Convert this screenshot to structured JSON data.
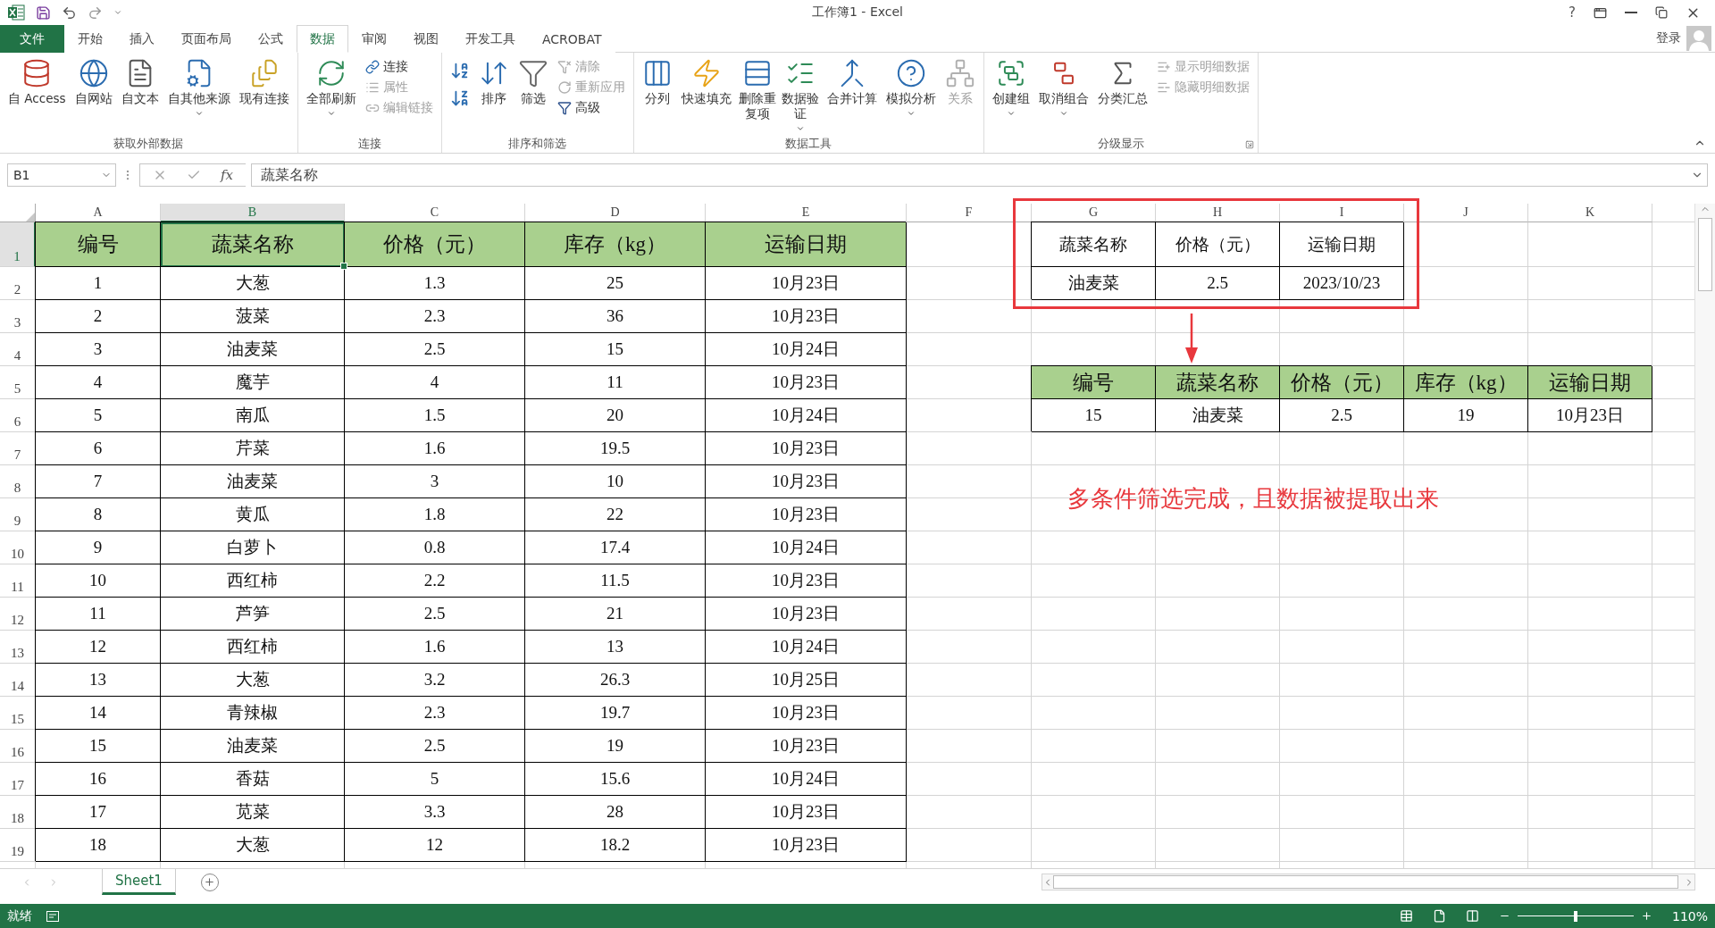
{
  "window": {
    "title": "工作簿1 - Excel",
    "help": "?"
  },
  "ribbon_tabs": [
    {
      "label": "文件",
      "kind": "file",
      "selected": false
    },
    {
      "label": "开始",
      "kind": "tab",
      "selected": false
    },
    {
      "label": "插入",
      "kind": "tab",
      "selected": false
    },
    {
      "label": "页面布局",
      "kind": "tab",
      "selected": false
    },
    {
      "label": "公式",
      "kind": "tab",
      "selected": false
    },
    {
      "label": "数据",
      "kind": "tab",
      "selected": true
    },
    {
      "label": "审阅",
      "kind": "tab",
      "selected": false
    },
    {
      "label": "视图",
      "kind": "tab",
      "selected": false
    },
    {
      "label": "开发工具",
      "kind": "tab",
      "selected": false
    },
    {
      "label": "ACROBAT",
      "kind": "tab",
      "selected": false
    }
  ],
  "account": {
    "label": "登录"
  },
  "ribbon_groups": [
    {
      "title": "获取外部数据",
      "dialog_launcher": false,
      "buttons": [
        {
          "label": "自 Access",
          "kind": "large",
          "disabled": false,
          "dropdown": false
        },
        {
          "label": "自网站",
          "kind": "large",
          "disabled": false,
          "dropdown": false
        },
        {
          "label": "自文本",
          "kind": "large",
          "disabled": false,
          "dropdown": false
        },
        {
          "label": "自其他来源",
          "kind": "large",
          "disabled": false,
          "dropdown": true
        },
        {
          "label": "现有连接",
          "kind": "large",
          "disabled": false,
          "dropdown": false
        }
      ]
    },
    {
      "title": "连接",
      "dialog_launcher": false,
      "buttons": [
        {
          "label": "全部刷新",
          "kind": "large",
          "disabled": false,
          "dropdown": true
        },
        {
          "label": "连接",
          "kind": "small",
          "disabled": false,
          "dropdown": false
        },
        {
          "label": "属性",
          "kind": "small",
          "disabled": true,
          "dropdown": false
        },
        {
          "label": "编辑链接",
          "kind": "small",
          "disabled": true,
          "dropdown": false
        }
      ]
    },
    {
      "title": "排序和筛选",
      "dialog_launcher": false,
      "buttons": [
        {
          "kind": "icon",
          "disabled": false
        },
        {
          "kind": "icon",
          "disabled": false
        },
        {
          "label": "排序",
          "kind": "large",
          "disabled": false,
          "dropdown": false
        },
        {
          "label": "筛选",
          "kind": "large",
          "disabled": false,
          "dropdown": false
        },
        {
          "label": "清除",
          "kind": "small",
          "disabled": true,
          "dropdown": false
        },
        {
          "label": "重新应用",
          "kind": "small",
          "disabled": true,
          "dropdown": false
        },
        {
          "label": "高级",
          "kind": "small",
          "disabled": false,
          "dropdown": false
        }
      ]
    },
    {
      "title": "数据工具",
      "dialog_launcher": false,
      "buttons": [
        {
          "label": "分列",
          "kind": "large",
          "disabled": false,
          "dropdown": false
        },
        {
          "label": "快速填充",
          "kind": "large",
          "disabled": false,
          "dropdown": false
        },
        {
          "label": "删除重复项",
          "kind": "wrapped",
          "disabled": false,
          "dropdown": false
        },
        {
          "label": "数据验证",
          "kind": "wrapped",
          "disabled": false,
          "dropdown": true
        },
        {
          "label": "合并计算",
          "kind": "large",
          "disabled": false,
          "dropdown": false
        },
        {
          "label": "模拟分析",
          "kind": "large",
          "disabled": false,
          "dropdown": true
        },
        {
          "label": "关系",
          "kind": "large",
          "disabled": true,
          "dropdown": false
        }
      ]
    },
    {
      "title": "分级显示",
      "dialog_launcher": true,
      "buttons": [
        {
          "label": "创建组",
          "kind": "large",
          "disabled": false,
          "dropdown": true
        },
        {
          "label": "取消组合",
          "kind": "large",
          "disabled": false,
          "dropdown": true
        },
        {
          "label": "分类汇总",
          "kind": "large",
          "disabled": false,
          "dropdown": false
        },
        {
          "label": "显示明细数据",
          "kind": "small",
          "disabled": true,
          "dropdown": false
        },
        {
          "label": "隐藏明细数据",
          "kind": "small",
          "disabled": true,
          "dropdown": false
        }
      ]
    }
  ],
  "formula_bar": {
    "name_box": "B1",
    "function_label": "fx",
    "value": "蔬菜名称"
  },
  "sheet": {
    "columns": [
      {
        "label": "A",
        "selected": false
      },
      {
        "label": "B",
        "selected": true
      },
      {
        "label": "C",
        "selected": false
      },
      {
        "label": "D",
        "selected": false
      },
      {
        "label": "E",
        "selected": false
      },
      {
        "label": "F",
        "selected": false
      },
      {
        "label": "G",
        "selected": false
      },
      {
        "label": "H",
        "selected": false
      },
      {
        "label": "I",
        "selected": false
      },
      {
        "label": "J",
        "selected": false
      },
      {
        "label": "K",
        "selected": false
      }
    ],
    "rows": [
      {
        "label": "1",
        "selected": true
      },
      {
        "label": "2",
        "selected": false
      },
      {
        "label": "3",
        "selected": false
      },
      {
        "label": "4",
        "selected": false
      },
      {
        "label": "5",
        "selected": false
      },
      {
        "label": "6",
        "selected": false
      },
      {
        "label": "7",
        "selected": false
      },
      {
        "label": "8",
        "selected": false
      },
      {
        "label": "9",
        "selected": false
      },
      {
        "label": "10",
        "selected": false
      },
      {
        "label": "11",
        "selected": false
      },
      {
        "label": "12",
        "selected": false
      },
      {
        "label": "13",
        "selected": false
      },
      {
        "label": "14",
        "selected": false
      },
      {
        "label": "15",
        "selected": false
      },
      {
        "label": "16",
        "selected": false
      },
      {
        "label": "17",
        "selected": false
      },
      {
        "label": "18",
        "selected": false
      },
      {
        "label": "19",
        "selected": false
      }
    ],
    "main_table": {
      "header": [
        {
          "text": "编号",
          "selected": false
        },
        {
          "text": "蔬菜名称",
          "selected": true
        },
        {
          "text": "价格（元）",
          "selected": false
        },
        {
          "text": "库存（kg）",
          "selected": false
        },
        {
          "text": "运输日期",
          "selected": false
        }
      ],
      "rows": [
        [
          "1",
          "大葱",
          "1.3",
          "25",
          "10月23日"
        ],
        [
          "2",
          "菠菜",
          "2.3",
          "36",
          "10月23日"
        ],
        [
          "3",
          "油麦菜",
          "2.5",
          "15",
          "10月24日"
        ],
        [
          "4",
          "魔芋",
          "4",
          "11",
          "10月23日"
        ],
        [
          "5",
          "南瓜",
          "1.5",
          "20",
          "10月24日"
        ],
        [
          "6",
          "芹菜",
          "1.6",
          "19.5",
          "10月23日"
        ],
        [
          "7",
          "油麦菜",
          "3",
          "10",
          "10月23日"
        ],
        [
          "8",
          "黄瓜",
          "1.8",
          "22",
          "10月23日"
        ],
        [
          "9",
          "白萝卜",
          "0.8",
          "17.4",
          "10月24日"
        ],
        [
          "10",
          "西红柿",
          "2.2",
          "11.5",
          "10月23日"
        ],
        [
          "11",
          "芦笋",
          "2.5",
          "21",
          "10月23日"
        ],
        [
          "12",
          "西红柿",
          "1.6",
          "13",
          "10月24日"
        ],
        [
          "13",
          "大葱",
          "3.2",
          "26.3",
          "10月25日"
        ],
        [
          "14",
          "青辣椒",
          "2.3",
          "19.7",
          "10月23日"
        ],
        [
          "15",
          "油麦菜",
          "2.5",
          "19",
          "10月23日"
        ],
        [
          "16",
          "香菇",
          "5",
          "15.6",
          "10月24日"
        ],
        [
          "17",
          "苋菜",
          "3.3",
          "28",
          "10月23日"
        ],
        [
          "18",
          "大葱",
          "12",
          "18.2",
          "10月23日"
        ]
      ]
    },
    "criteria_table": {
      "header": [
        "蔬菜名称",
        "价格（元）",
        "运输日期"
      ],
      "rows": [
        [
          "油麦菜",
          "2.5",
          "2023/10/23"
        ]
      ]
    },
    "result_table": {
      "header": [
        "编号",
        "蔬菜名称",
        "价格（元）",
        "库存（kg）",
        "运输日期"
      ],
      "rows": [
        [
          "15",
          "油麦菜",
          "2.5",
          "19",
          "10月23日"
        ]
      ]
    },
    "annotation": "多条件筛选完成，且数据被提取出来"
  },
  "sheet_tabs": [
    {
      "label": "Sheet1",
      "selected": true
    }
  ],
  "status_bar": {
    "status": "就绪",
    "zoom": {
      "level": 0.5,
      "reading": "110%"
    }
  }
}
